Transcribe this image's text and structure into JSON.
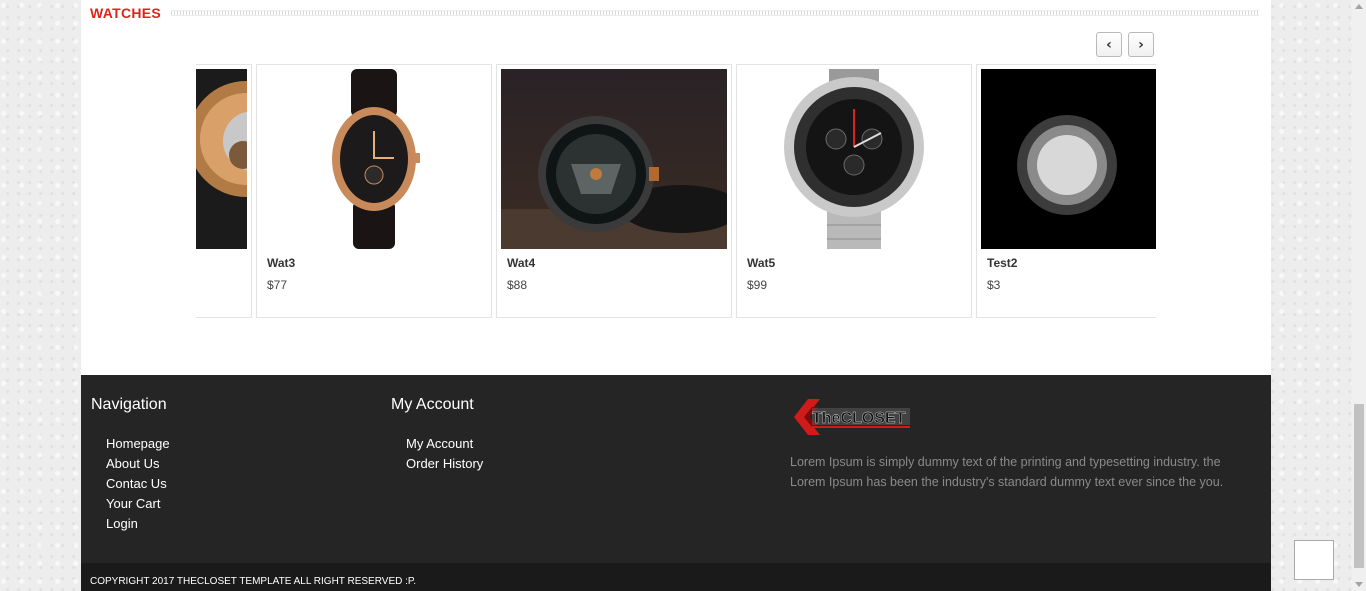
{
  "section": {
    "title": "WATCHES"
  },
  "carousel": {
    "prev_label": "‹",
    "next_label": "›",
    "products": [
      {
        "name": "",
        "price": ""
      },
      {
        "name": "Wat3",
        "price": "$77"
      },
      {
        "name": "Wat4",
        "price": "$88"
      },
      {
        "name": "Wat5",
        "price": "$99"
      },
      {
        "name": "Test2",
        "price": "$3"
      }
    ]
  },
  "footer": {
    "navigation": {
      "title": "Navigation",
      "items": [
        "Homepage",
        "About Us",
        "Contac Us",
        "Your Cart",
        "Login"
      ]
    },
    "account": {
      "title": "My Account",
      "items": [
        "My Account",
        "Order History"
      ]
    },
    "brand": {
      "logo_text": "TheCLOSET",
      "description": "Lorem Ipsum is simply dummy text of the printing and typesetting industry. the Lorem Ipsum has been the industry's standard dummy text ever since the you."
    },
    "copyright": "COPYRIGHT 2017 THECLOSET TEMPLATE ALL RIGHT RESERVED :P."
  },
  "colors": {
    "accent": "#e0231a",
    "footer_bg": "#252525",
    "copyright_bg": "#1a1a1a"
  }
}
